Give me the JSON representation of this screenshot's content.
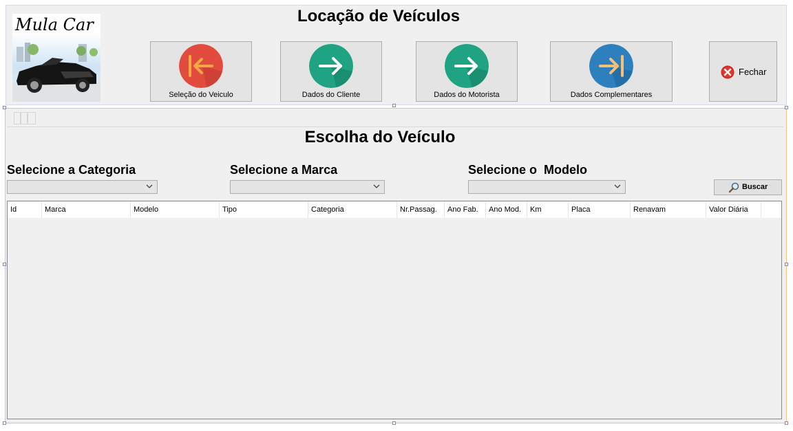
{
  "window": {
    "title": "Locação de Veículos"
  },
  "logo": {
    "text": "Mula Car"
  },
  "nav": {
    "steps": [
      {
        "label": "Seleção do Veiculo",
        "icon": "arrow-left-to-bar-icon",
        "color": "#e24c3f"
      },
      {
        "label": "Dados do Cliente",
        "icon": "arrow-right-icon",
        "color": "#1fa383"
      },
      {
        "label": "Dados do Motorista",
        "icon": "arrow-right-icon",
        "color": "#1fa383"
      },
      {
        "label": "Dados Complementares",
        "icon": "arrow-right-to-bar-icon",
        "color": "#2e7fbd"
      }
    ],
    "close_label": "Fechar"
  },
  "main": {
    "title": "Escolha do Veículo",
    "category_label": "Selecione a Categoria",
    "brand_label": "Selecione a Marca",
    "model_label": "Selecione o  Modelo",
    "category_value": "",
    "brand_value": "",
    "model_value": "",
    "search_label": "Buscar"
  },
  "grid": {
    "columns": [
      "Id",
      "Marca",
      "Modelo",
      "Tipo",
      "Categoria",
      "Nr.Passag.",
      "Ano Fab.",
      "Ano Mod.",
      "Km",
      "Placa",
      "Renavam",
      "Valor Diária"
    ],
    "rows": []
  },
  "colors": {
    "accent_red": "#e24c3f",
    "accent_green": "#1fa383",
    "accent_blue": "#2e7fbd",
    "arrow_orange": "#f5a742"
  }
}
